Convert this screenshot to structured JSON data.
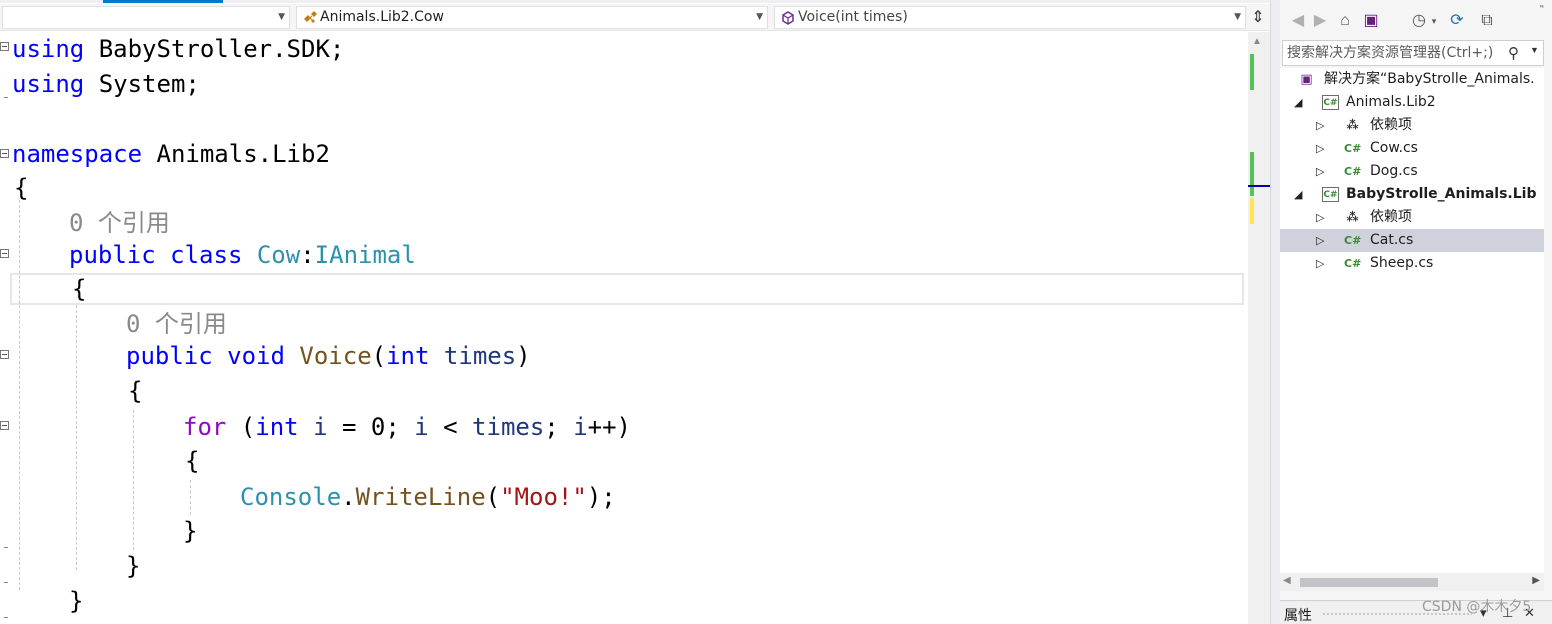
{
  "navbar": {
    "dropdown1": "",
    "dropdown2": "Animals.Lib2.Cow",
    "dropdown3": "Voice(int times)"
  },
  "code": {
    "line1": {
      "kw": "using",
      "rest": " BabyStroller.SDK;"
    },
    "line2": {
      "kw": "using",
      "rest": " System;"
    },
    "line3": {
      "kw": "namespace",
      "rest": " Animals.Lib2"
    },
    "line4": "{",
    "hint1": "0 个引用",
    "line5": {
      "kw1": "public",
      "kw2": "class",
      "type": "Cow",
      "colon": ":",
      "iface": "IAnimal"
    },
    "line6": "{",
    "hint2": "0 个引用",
    "line7": {
      "kw1": "public",
      "kw2": "void",
      "method": "Voice",
      "open": "(",
      "kw3": "int",
      "param": "times",
      "close": ")"
    },
    "line8": "{",
    "line9": {
      "kw": "for",
      "p1": " (",
      "kw2": "int",
      "v1": "i",
      "p2": " = 0; ",
      "v2": "i",
      "p3": " < ",
      "v3": "times",
      "p4": "; ",
      "v4": "i",
      "p5": "++)"
    },
    "line10": "{",
    "line11": {
      "type": "Console",
      "dot": ".",
      "method": "WriteLine",
      "open": "(",
      "str": "\"Moo!\"",
      "close": ");"
    },
    "line12": "}",
    "line13": "}",
    "line14": "}"
  },
  "solution_explorer": {
    "search_placeholder": "搜索解决方案资源管理器(Ctrl+;)",
    "items": [
      {
        "label": "解决方案“BabyStrolle_Animals.",
        "icon": "solution-icon"
      },
      {
        "label": "Animals.Lib2",
        "icon": "csharp-project-icon",
        "expanded": true
      },
      {
        "label": "依赖项",
        "icon": "dependencies-icon"
      },
      {
        "label": "Cow.cs",
        "icon": "csharp-file-icon"
      },
      {
        "label": "Dog.cs",
        "icon": "csharp-file-icon"
      },
      {
        "label": "BabyStrolle_Animals.Lib",
        "icon": "csharp-project-icon",
        "expanded": true,
        "bold": true
      },
      {
        "label": "依赖项",
        "icon": "dependencies-icon"
      },
      {
        "label": "Cat.cs",
        "icon": "csharp-file-icon",
        "selected": true
      },
      {
        "label": "Sheep.cs",
        "icon": "csharp-file-icon"
      }
    ]
  },
  "properties": {
    "title": "属性"
  },
  "watermark": "CSDN @木木夕5",
  "colors": {
    "keyword": "#0000ff",
    "control_keyword": "#8f08c4",
    "type": "#2b91af",
    "method": "#74531f",
    "string": "#a31515",
    "parameter": "#1f377f",
    "hint": "#8a8a8a",
    "selection": "#cfd1dc"
  }
}
